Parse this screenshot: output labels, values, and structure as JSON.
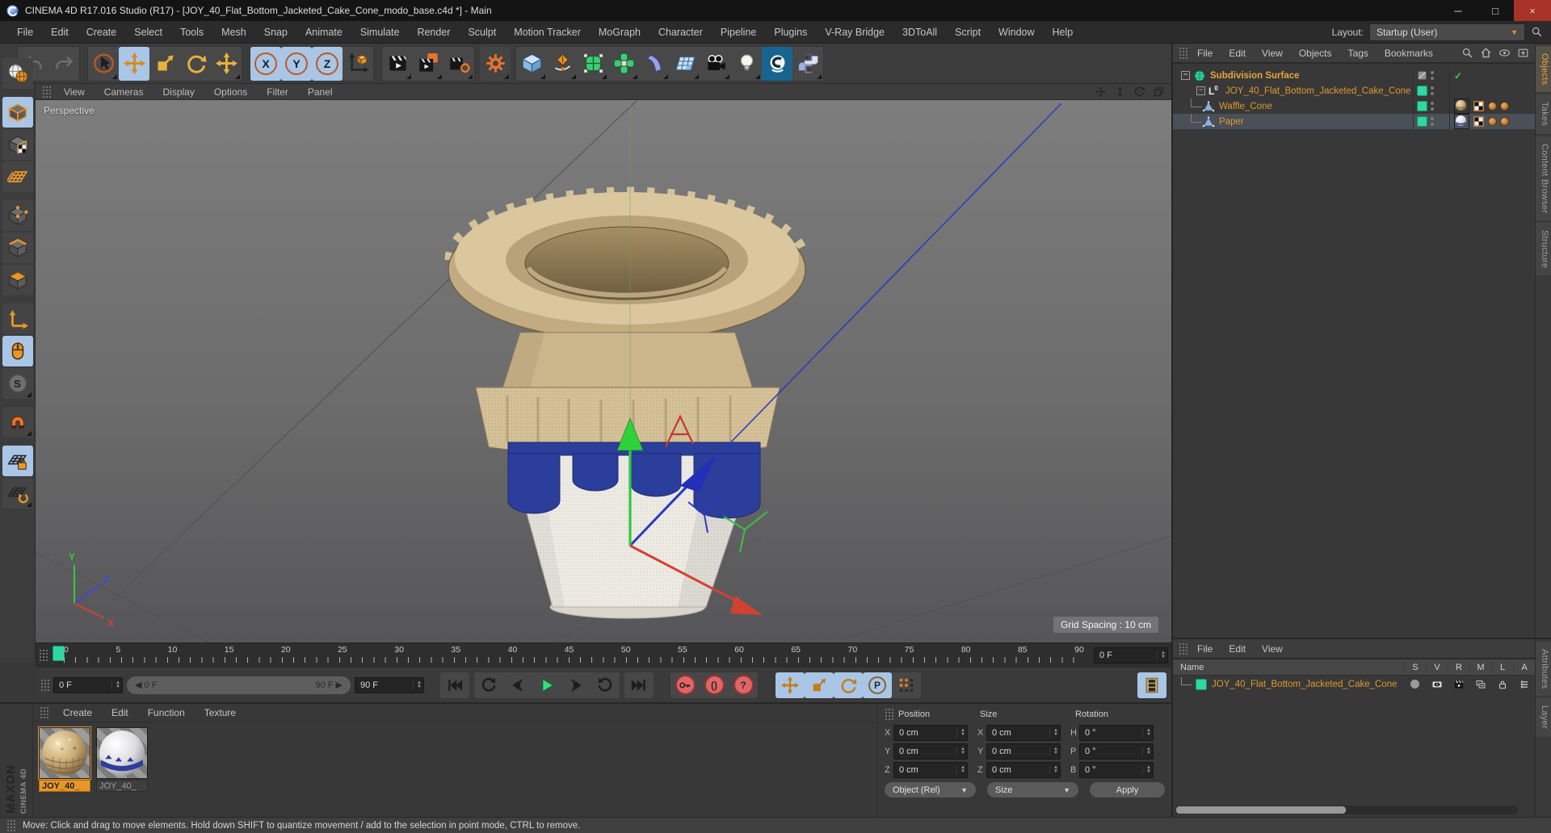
{
  "window": {
    "title": "CINEMA 4D R17.016 Studio (R17) - [JOY_40_Flat_Bottom_Jacketed_Cake_Cone_modo_base.c4d *] - Main"
  },
  "glyphs": {
    "minimize": "─",
    "maximize": "□",
    "close": "×",
    "caret_down": "▼",
    "caret_up": "▲",
    "left_arrow": "◀",
    "right_arrow": "▶",
    "collapse_minus": "−",
    "check": "✓",
    "parens": "()",
    "question": "?",
    "p_letter": "P",
    "s_letter": "S"
  },
  "menubar": {
    "items": [
      "File",
      "Edit",
      "Create",
      "Select",
      "Tools",
      "Mesh",
      "Snap",
      "Animate",
      "Simulate",
      "Render",
      "Sculpt",
      "Motion Tracker",
      "MoGraph",
      "Character",
      "Pipeline",
      "Plugins",
      "V-Ray Bridge",
      "3DToAll",
      "Script",
      "Window",
      "Help"
    ],
    "layout_label": "Layout:",
    "layout_value": "Startup (User)"
  },
  "toolbar": {
    "axis_x": "X",
    "axis_y": "Y",
    "axis_z": "Z"
  },
  "viewport": {
    "menu": [
      "View",
      "Cameras",
      "Display",
      "Options",
      "Filter",
      "Panel"
    ],
    "camera_label": "Perspective",
    "grid_spacing": "Grid Spacing : 10 cm",
    "axis_x": "X",
    "axis_y": "Y",
    "axis_z": "Z"
  },
  "object_manager": {
    "menu": [
      "File",
      "Edit",
      "View",
      "Objects",
      "Tags",
      "Bookmarks"
    ],
    "tabs": [
      "Objects",
      "Takes",
      "Content Browser",
      "Structure"
    ],
    "tree": {
      "row1": "Subdivision Surface",
      "row2": "JOY_40_Flat_Bottom_Jacketed_Cake_Cone",
      "row3": "Waffle_Cone",
      "row4": "Paper"
    }
  },
  "timeline": {
    "ticks": [
      "0",
      "5",
      "10",
      "15",
      "20",
      "25",
      "30",
      "35",
      "40",
      "45",
      "50",
      "55",
      "60",
      "65",
      "70",
      "75",
      "80",
      "85",
      "90"
    ],
    "frame_field": "0 F",
    "start_field": "0 F",
    "range_start": "0 F",
    "range_end": "90 F",
    "end_field": "90 F"
  },
  "materials": {
    "menu": [
      "Create",
      "Edit",
      "Function",
      "Texture"
    ],
    "items": [
      {
        "label": "JOY_40_"
      },
      {
        "label": "JOY_40_"
      }
    ]
  },
  "coordinates": {
    "headers": [
      "Position",
      "Size",
      "Rotation"
    ],
    "rows": [
      {
        "pl": "X",
        "pv": "0 cm",
        "sl": "X",
        "sv": "0 cm",
        "rl": "H",
        "rv": "0 °"
      },
      {
        "pl": "Y",
        "pv": "0 cm",
        "sl": "Y",
        "sv": "0 cm",
        "rl": "P",
        "rv": "0 °"
      },
      {
        "pl": "Z",
        "pv": "0 cm",
        "sl": "Z",
        "sv": "0 cm",
        "rl": "B",
        "rv": "0 °"
      }
    ],
    "mode_dropdown": "Object (Rel)",
    "size_dropdown": "Size",
    "apply_label": "Apply"
  },
  "attribute_manager": {
    "menu": [
      "File",
      "Edit",
      "View"
    ],
    "name_header": "Name",
    "columns": [
      "S",
      "V",
      "R",
      "M",
      "L",
      "A"
    ],
    "row_label": "JOY_40_Flat_Bottom_Jacketed_Cake_Cone",
    "tabs": [
      "Attributes",
      "Layer"
    ]
  },
  "branding": {
    "maxon": "MAXON",
    "cinema": "CINEMA 4D"
  },
  "status": {
    "text": "Move: Click and drag to move elements. Hold down SHIFT to quantize movement / add to the selection in point mode, CTRL to remove."
  }
}
